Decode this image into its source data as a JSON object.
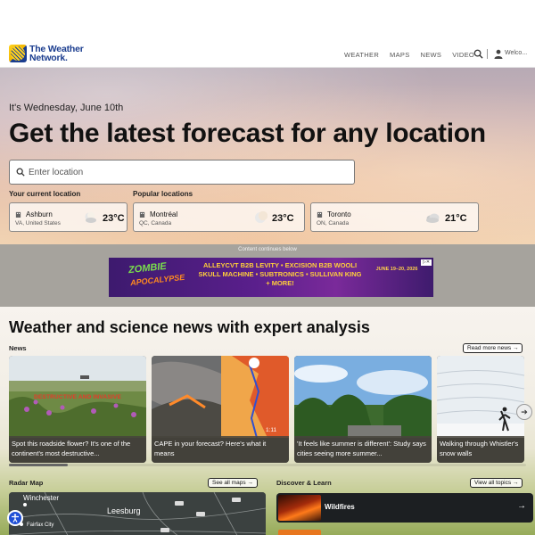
{
  "header": {
    "logo_line1": "The Weather",
    "logo_line2": "Network.",
    "nav": [
      "WEATHER",
      "MAPS",
      "NEWS",
      "VIDEO"
    ],
    "welcome": "Welco..."
  },
  "hero": {
    "date": "It's Wednesday, June 10th",
    "headline": "Get the latest forecast for any location",
    "search_placeholder": "Enter location",
    "current_label": "Your current location",
    "popular_label": "Popular locations",
    "cards": [
      {
        "city": "Ashburn",
        "region": "VA, United States",
        "temp": "23°C",
        "icon": "partly-cloudy-night-icon"
      },
      {
        "city": "Montréal",
        "region": "QC, Canada",
        "temp": "23°C",
        "icon": "clear-night-icon"
      },
      {
        "city": "Toronto",
        "region": "ON, Canada",
        "temp": "21°C",
        "icon": "cloudy-icon"
      }
    ]
  },
  "ad": {
    "notice": "Content continues below",
    "brand_top": "ZOMBIE",
    "brand_bottom": "APOCALYPSE",
    "lineup1": "ALLEYCVT B2B LEVITY • EXCISION B2B WOOLI",
    "lineup2": "SKULL MACHINE • SUBTRONICS • SULLIVAN KING",
    "lineup3": "+ MORE!",
    "dates": "JUNE 19–20, 2026"
  },
  "news": {
    "title": "Weather and science news with expert analysis",
    "label": "News",
    "read_more": "Read more news →",
    "articles": [
      {
        "caption": "Spot this roadside flower? It's one of the continent's most destructive...",
        "overlay": "DESTRUCTIVE AND INVASIVE"
      },
      {
        "caption": "CAPE in your forecast? Here's what it means",
        "duration": "1:11"
      },
      {
        "caption": "'It feels like summer is different': Study says cities seeing more summer..."
      },
      {
        "caption": "Walking through Whistler's snow walls"
      }
    ],
    "next_icon": "chevron-right-icon"
  },
  "radar": {
    "label": "Radar Map",
    "see_all": "See all maps →",
    "towns": [
      "Winchester",
      "Leesburg",
      "Fairfax City"
    ]
  },
  "discover": {
    "label": "Discover & Learn",
    "see_all": "View all topics →",
    "items": [
      {
        "title": "Wildfires"
      }
    ]
  },
  "colors": {
    "brand_blue": "#1b3d8f",
    "brand_yellow": "#ffd21f",
    "accessibility_blue": "#1f4fd6"
  }
}
